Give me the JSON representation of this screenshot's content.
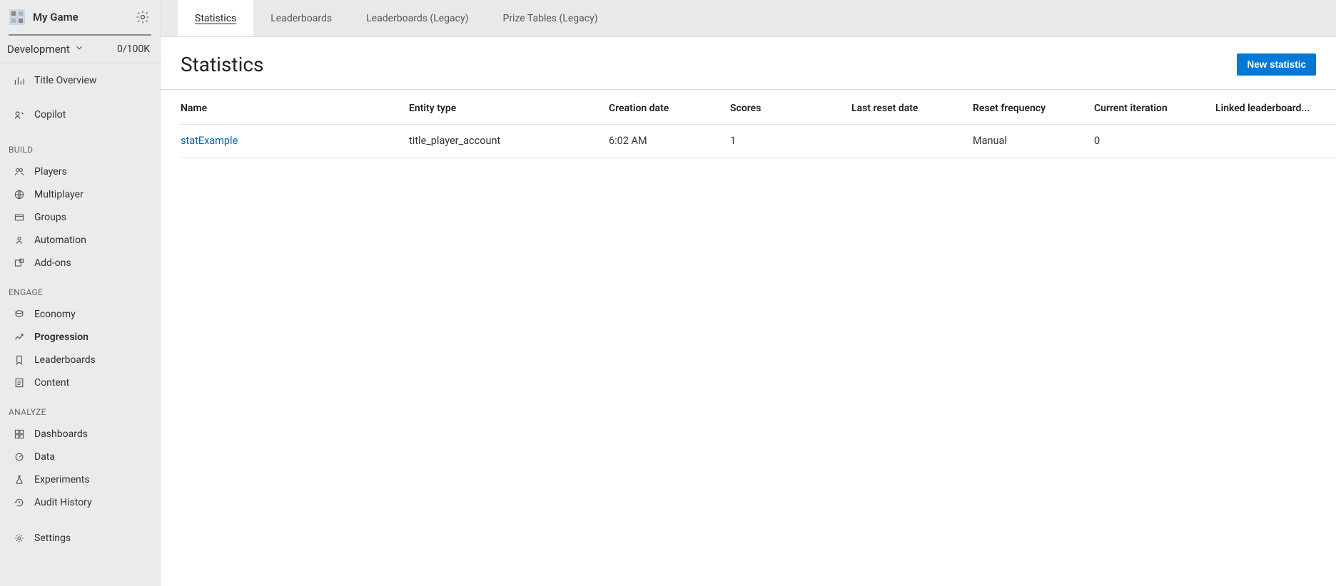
{
  "sidebar": {
    "game_title": "My Game",
    "env_label": "Development",
    "env_count": "0/100K",
    "sections": {
      "build": "BUILD",
      "engage": "ENGAGE",
      "analyze": "ANALYZE"
    },
    "items": {
      "title_overview": "Title Overview",
      "copilot": "Copilot",
      "players": "Players",
      "multiplayer": "Multiplayer",
      "groups": "Groups",
      "automation": "Automation",
      "addons": "Add-ons",
      "economy": "Economy",
      "progression": "Progression",
      "leaderboards": "Leaderboards",
      "content": "Content",
      "dashboards": "Dashboards",
      "data": "Data",
      "experiments": "Experiments",
      "audit_history": "Audit History",
      "settings": "Settings"
    }
  },
  "tabs": {
    "statistics": "Statistics",
    "leaderboards": "Leaderboards",
    "leaderboards_legacy": "Leaderboards (Legacy)",
    "prize_tables_legacy": "Prize Tables (Legacy)"
  },
  "page": {
    "title": "Statistics",
    "new_button": "New statistic"
  },
  "table": {
    "headers": {
      "name": "Name",
      "entity_type": "Entity type",
      "creation_date": "Creation date",
      "scores": "Scores",
      "last_reset_date": "Last reset date",
      "reset_frequency": "Reset frequency",
      "current_iteration": "Current iteration",
      "linked": "Linked leaderboard..."
    },
    "rows": [
      {
        "name": "statExample",
        "entity_type": "title_player_account",
        "creation_date": "6:02 AM",
        "scores": "1",
        "last_reset_date": "",
        "reset_frequency": "Manual",
        "current_iteration": "0",
        "linked": ""
      }
    ]
  }
}
